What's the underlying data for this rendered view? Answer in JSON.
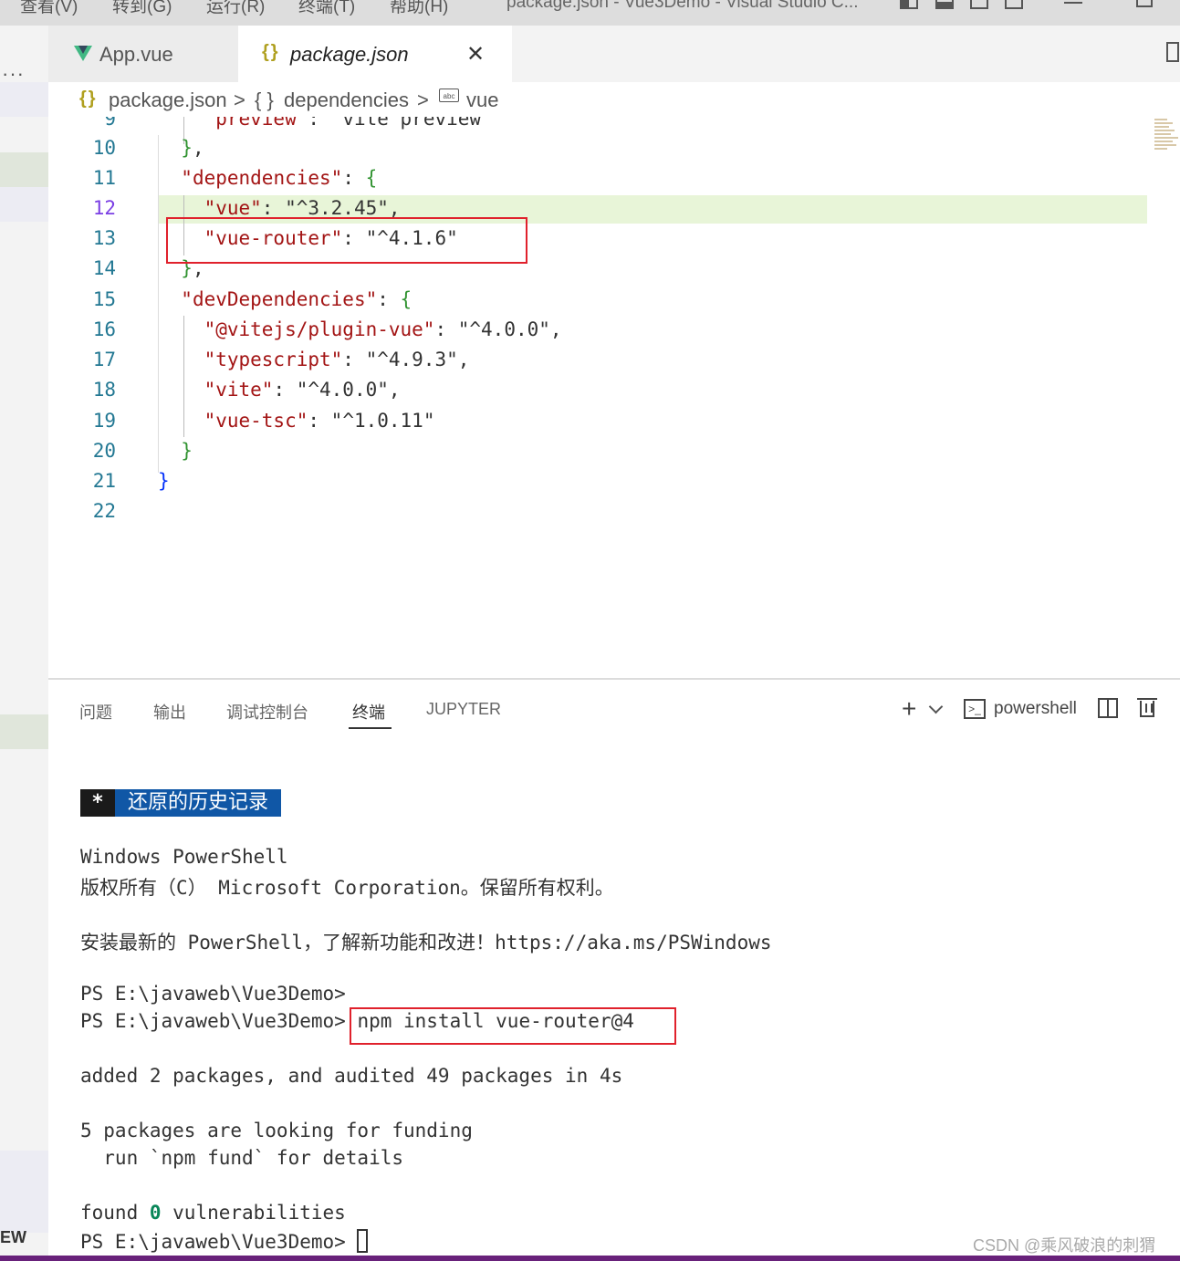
{
  "menubar": {
    "items": [
      "查看(V)",
      "转到(G)",
      "运行(R)",
      "终端(T)",
      "帮助(H)"
    ],
    "window_title": "package.json - Vue3Demo - Visual Studio C..."
  },
  "activity": {
    "bottom_text": "EW"
  },
  "tabs": [
    {
      "label": "App.vue",
      "icon": "vue-icon"
    },
    {
      "label": "package.json",
      "icon": "json-braces-icon"
    }
  ],
  "breadcrumb": {
    "file": "package.json",
    "sep1": ">",
    "braces": "{ }",
    "section": "dependencies",
    "sep2": ">",
    "item": "vue"
  },
  "editor": {
    "lines": [
      {
        "n": "9",
        "text": "    \"preview\": \"vite preview\""
      },
      {
        "n": "10",
        "text": "  },"
      },
      {
        "n": "11",
        "text": "  \"dependencies\": {"
      },
      {
        "n": "12",
        "text": "    \"vue\": \"^3.2.45\","
      },
      {
        "n": "13",
        "text": "    \"vue-router\": \"^4.1.6\""
      },
      {
        "n": "14",
        "text": "  },"
      },
      {
        "n": "15",
        "text": "  \"devDependencies\": {"
      },
      {
        "n": "16",
        "text": "    \"@vitejs/plugin-vue\": \"^4.0.0\","
      },
      {
        "n": "17",
        "text": "    \"typescript\": \"^4.9.3\","
      },
      {
        "n": "18",
        "text": "    \"vite\": \"^4.0.0\","
      },
      {
        "n": "19",
        "text": "    \"vue-tsc\": \"^1.0.11\""
      },
      {
        "n": "20",
        "text": "  }"
      },
      {
        "n": "21",
        "text": "}"
      },
      {
        "n": "22",
        "text": ""
      }
    ],
    "active_line": "12"
  },
  "panel": {
    "tabs": [
      "问题",
      "输出",
      "调试控制台",
      "终端",
      "JUPYTER"
    ],
    "active_tab": "终端",
    "shell_label": "powershell"
  },
  "terminal": {
    "restore_star": "*",
    "restore_label": "还原的历史记录",
    "line1": "Windows PowerShell",
    "line2": "版权所有（C） Microsoft Corporation。保留所有权利。",
    "line3": "安装最新的 PowerShell，了解新功能和改进！https://aka.ms/PSWindows",
    "prompt": "PS E:\\javaweb\\Vue3Demo>",
    "command": " npm install vue-router@4",
    "added": "added 2 packages, and audited 49 packages in 4s",
    "funding1": "5 packages are looking for funding",
    "funding2": "  run `npm fund` for details",
    "found_pre": "found ",
    "found_zero": "0",
    "found_post": " vulnerabilities"
  },
  "watermark": "CSDN @乘风破浪的刺猬",
  "colors": {
    "statusbar": "#68217a",
    "highlight_box": "#e0212c",
    "restore_bg": "#1057a6"
  }
}
